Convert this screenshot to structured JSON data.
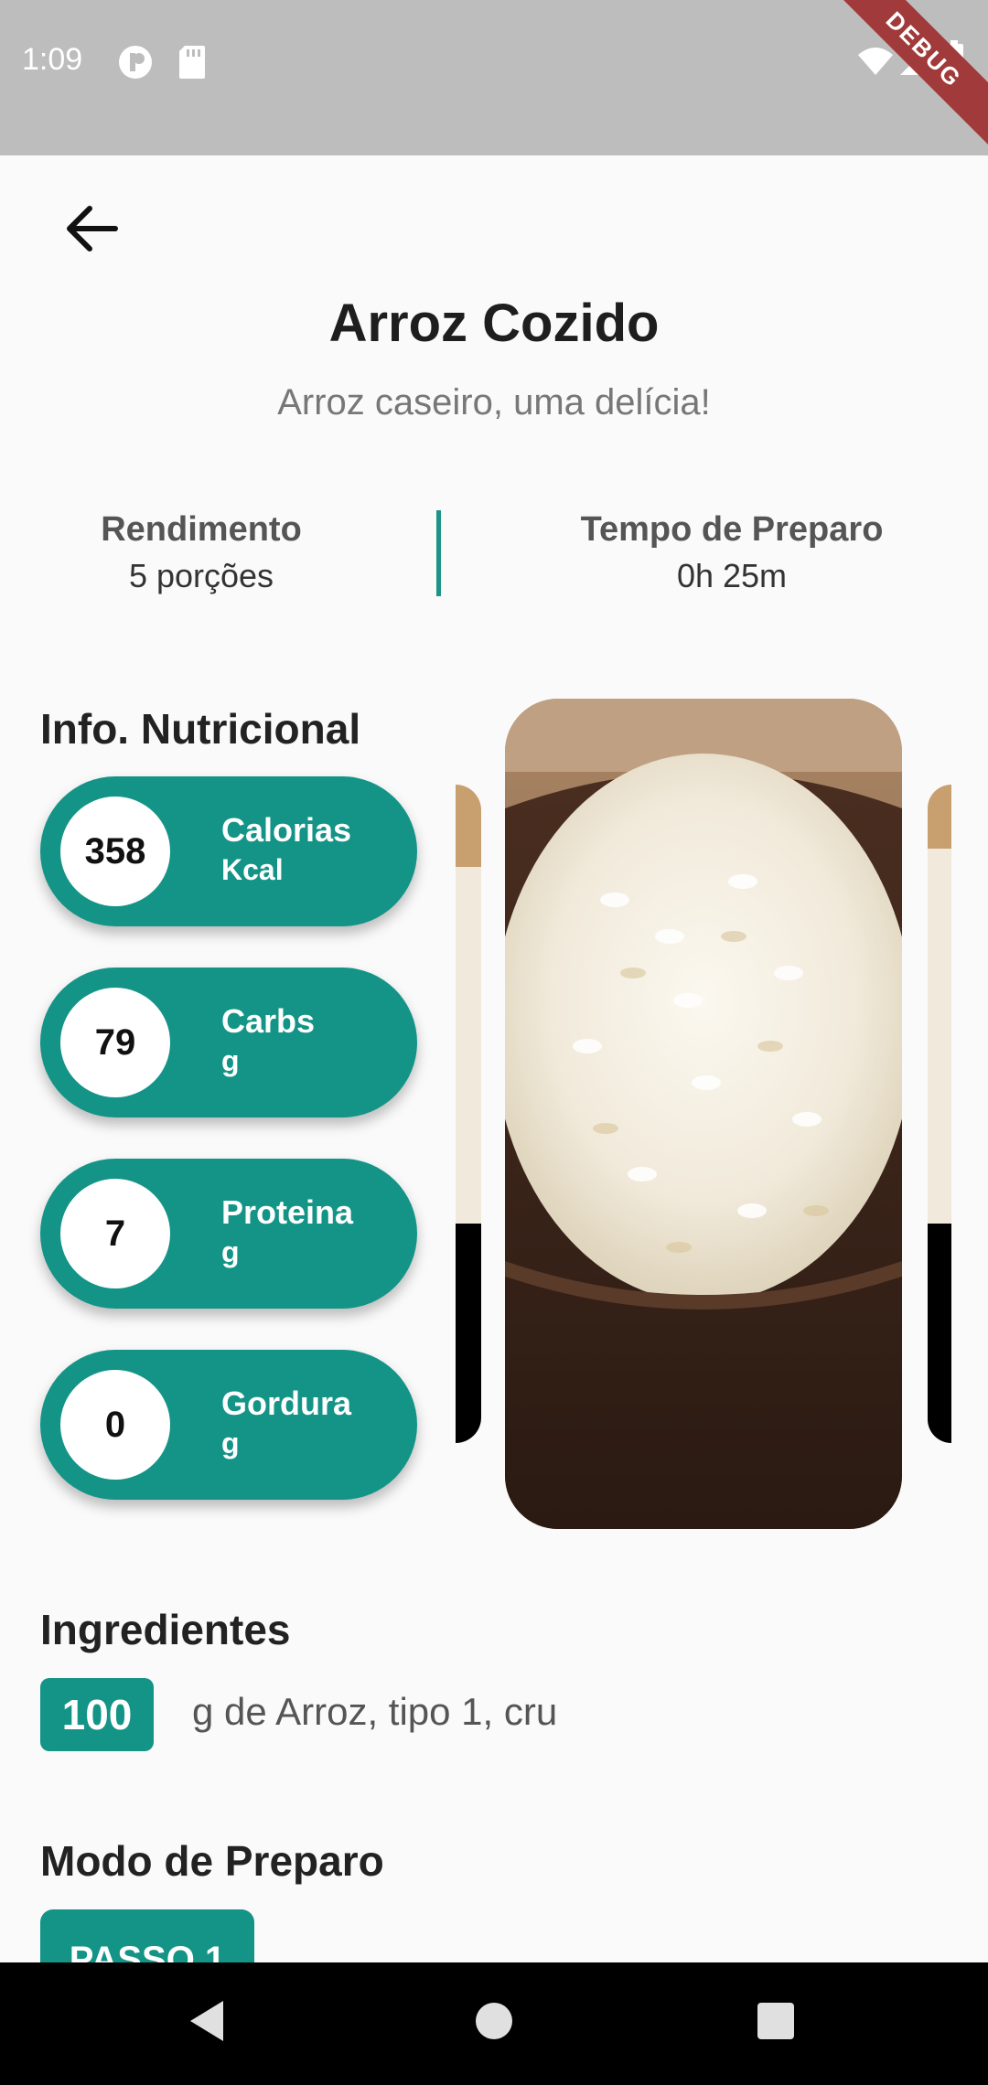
{
  "status_bar": {
    "time": "1:09",
    "debug_label": "DEBUG"
  },
  "recipe": {
    "title": "Arroz Cozido",
    "subtitle": "Arroz caseiro, uma delícia!"
  },
  "stats": {
    "yield_label": "Rendimento",
    "yield_value": "5 porções",
    "time_label": "Tempo de Preparo",
    "time_value": "0h 25m"
  },
  "nutrition": {
    "section_title": "Info. Nutricional",
    "items": [
      {
        "value": "358",
        "name": "Calorias",
        "unit": "Kcal"
      },
      {
        "value": "79",
        "name": "Carbs",
        "unit": "g"
      },
      {
        "value": "7",
        "name": "Proteina",
        "unit": "g"
      },
      {
        "value": "0",
        "name": "Gordura",
        "unit": "g"
      }
    ]
  },
  "ingredients": {
    "section_title": "Ingredientes",
    "items": [
      {
        "quantity": "100",
        "text": "g de Arroz, tipo 1, cru"
      }
    ]
  },
  "preparation": {
    "section_title": "Modo de Preparo",
    "steps": [
      {
        "label": "PASSO 1"
      }
    ]
  },
  "colors": {
    "accent": "#139487",
    "status_bar": "#bdbdbd",
    "background": "#fafafa"
  },
  "icons": [
    "back-arrow-icon",
    "wifi-icon",
    "signal-icon",
    "battery-icon",
    "nav-back-icon",
    "nav-home-icon",
    "nav-recents-icon"
  ]
}
